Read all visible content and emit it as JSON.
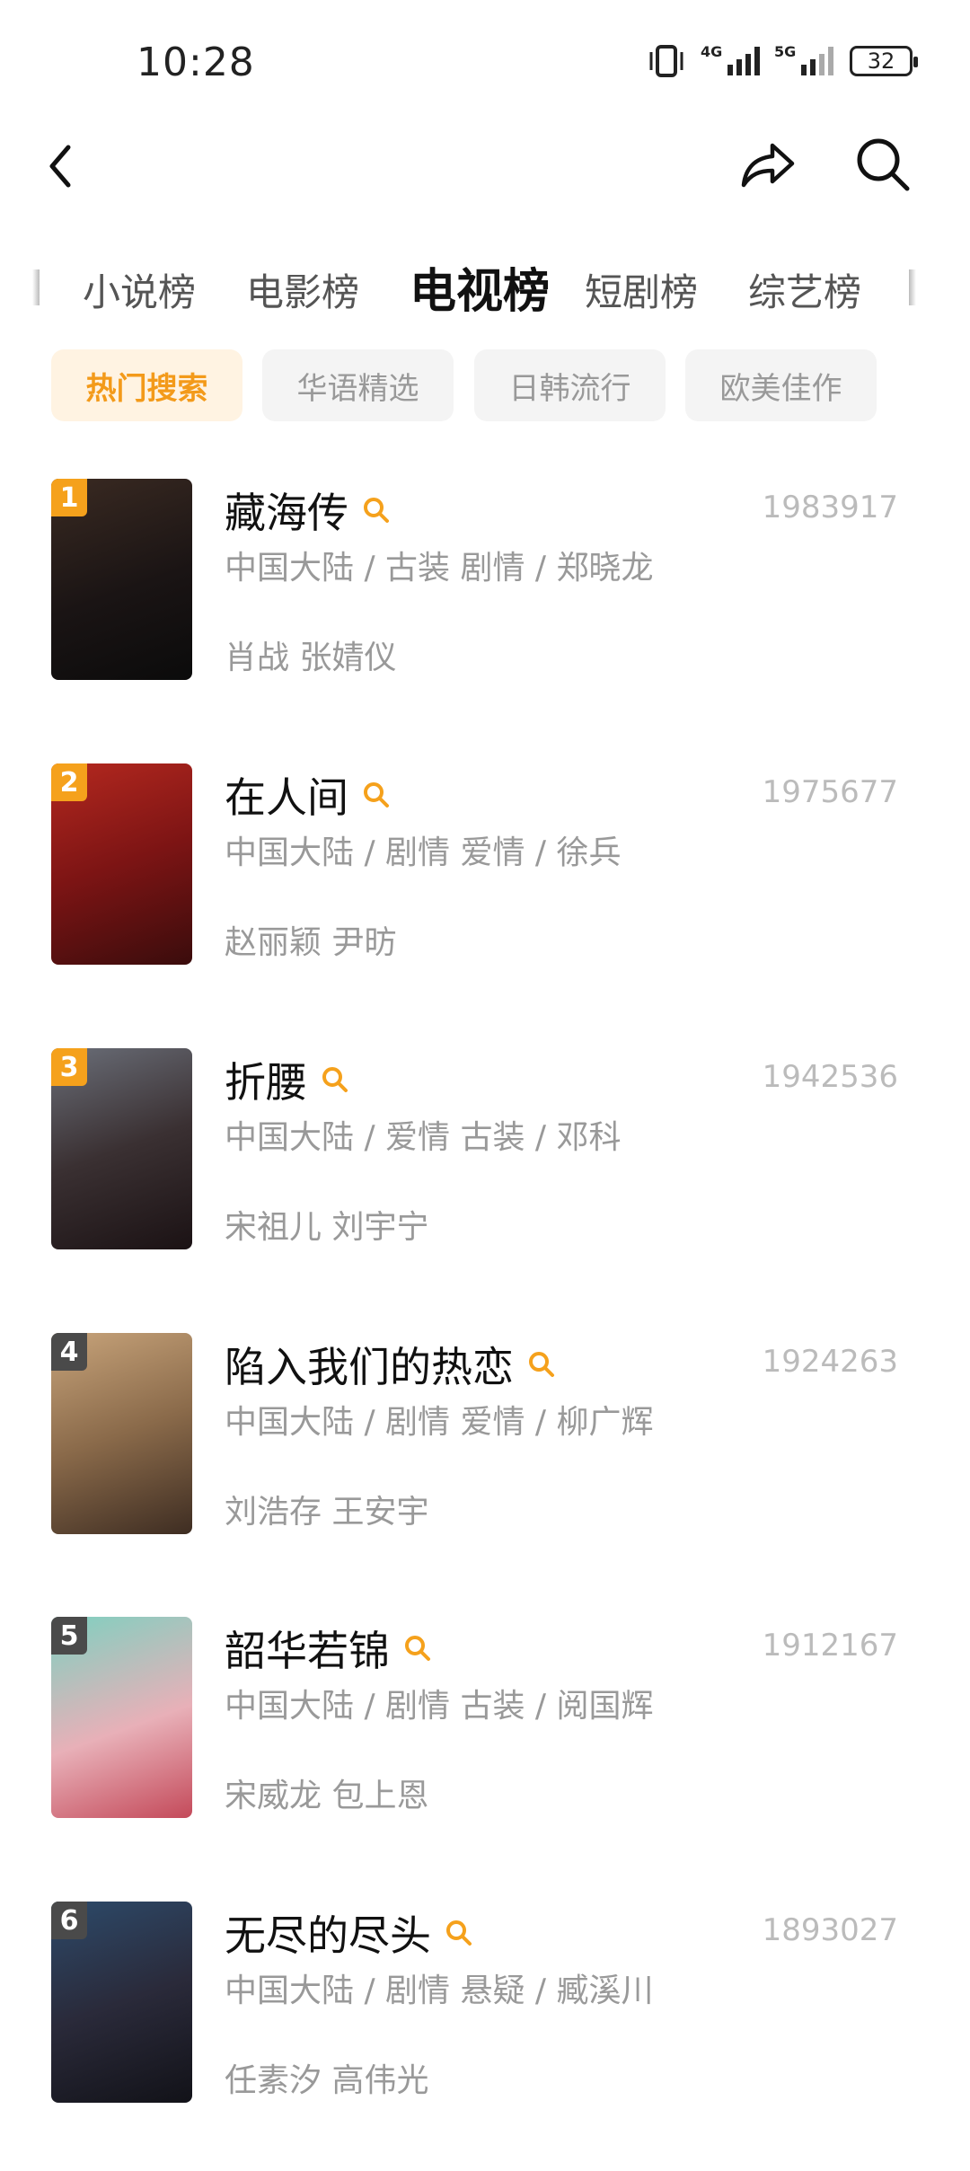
{
  "status_bar": {
    "time": "10:28",
    "net1": "4G",
    "net2": "5G",
    "battery": "32"
  },
  "rank_tabs": [
    "小说榜",
    "电影榜",
    "电视榜",
    "短剧榜",
    "综艺榜"
  ],
  "active_rank_tab": "电视榜",
  "filters": [
    "热门搜索",
    "华语精选",
    "日韩流行",
    "欧美佳作"
  ],
  "active_filter": "热门搜索",
  "accent_color": "#f5a11c",
  "items": [
    {
      "rank": "1",
      "title": "藏海传",
      "score": "1983917",
      "meta": "中国大陆 / 古装 剧情 / 郑晓龙",
      "cast": "肖战 张婧仪",
      "rank_color": "#f5a11c"
    },
    {
      "rank": "2",
      "title": "在人间",
      "score": "1975677",
      "meta": "中国大陆 / 剧情 爱情 / 徐兵",
      "cast": "赵丽颖 尹昉",
      "rank_color": "#f5a11c"
    },
    {
      "rank": "3",
      "title": "折腰",
      "score": "1942536",
      "meta": "中国大陆 / 爱情 古装 / 邓科",
      "cast": "宋祖儿 刘宇宁",
      "rank_color": "#f5a11c"
    },
    {
      "rank": "4",
      "title": "陷入我们的热恋",
      "score": "1924263",
      "meta": "中国大陆 / 剧情 爱情 / 柳广辉",
      "cast": "刘浩存 王安宇",
      "rank_color": "#4a4a4a"
    },
    {
      "rank": "5",
      "title": "韶华若锦",
      "score": "1912167",
      "meta": "中国大陆 / 剧情 古装 / 阅国辉",
      "cast": "宋威龙 包上恩",
      "rank_color": "#4a4a4a"
    },
    {
      "rank": "6",
      "title": "无尽的尽头",
      "score": "1893027",
      "meta": "中国大陆 / 剧情 悬疑 / 臧溪川",
      "cast": "任素汐 高伟光",
      "rank_color": "#4a4a4a"
    }
  ]
}
